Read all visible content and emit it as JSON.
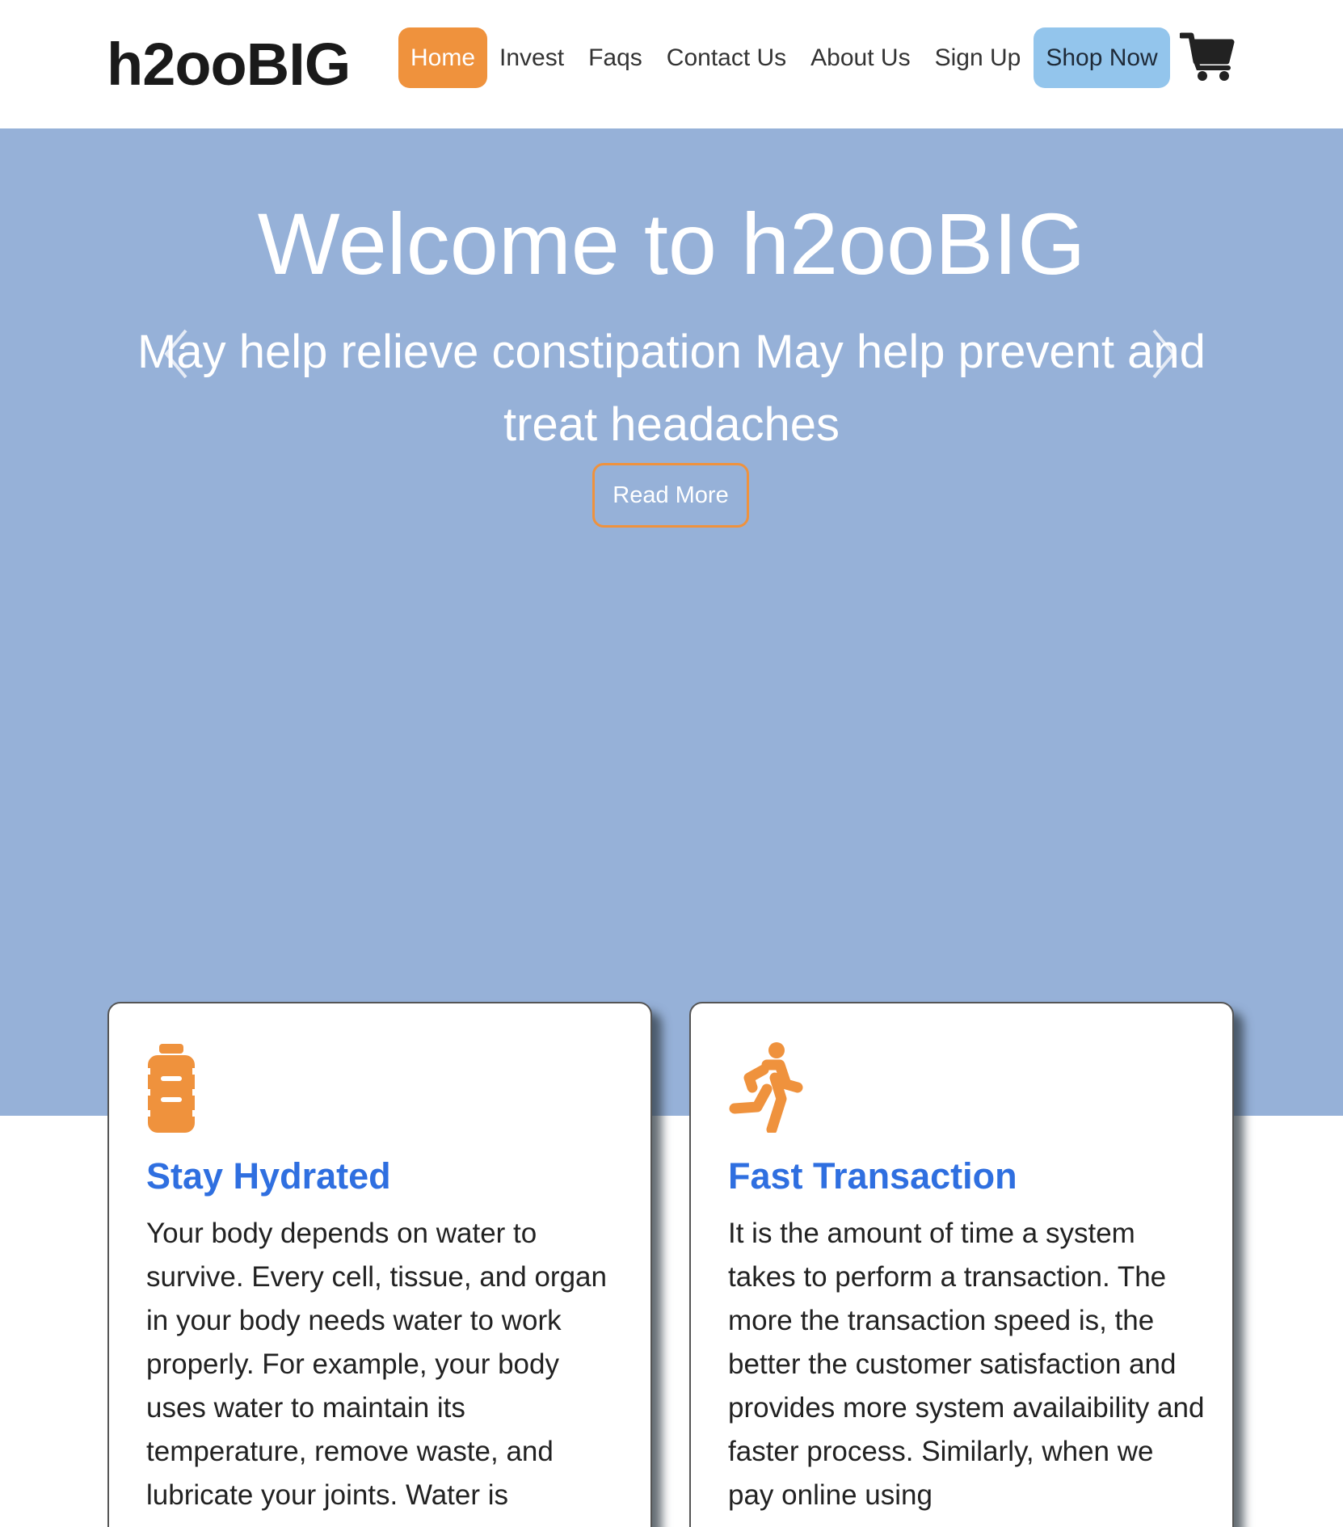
{
  "header": {
    "brand": "h2ooBIG",
    "nav": [
      {
        "label": "Home",
        "active": true
      },
      {
        "label": "Invest"
      },
      {
        "label": "Faqs"
      },
      {
        "label": "Contact Us"
      },
      {
        "label": "About Us"
      },
      {
        "label": "Sign Up"
      }
    ],
    "shop_label": "Shop Now",
    "cart_icon": "shopping-cart-icon"
  },
  "hero": {
    "title": "Welcome to h2ooBIG",
    "subtitle": "May help relieve constipation May help prevent and treat headaches",
    "button_label": "Read More",
    "prev_icon": "chevron-left-icon",
    "next_icon": "chevron-right-icon"
  },
  "cards": [
    {
      "icon": "water-bottle-icon",
      "title": "Stay Hydrated",
      "text": "Your body depends on water to survive. Every cell, tissue, and organ in your body needs water to work properly. For example, your body uses water to maintain its temperature, remove waste, and lubricate your joints. Water is"
    },
    {
      "icon": "running-person-icon",
      "title": "Fast Transaction",
      "text": "It is the amount of time a system takes to perform a transaction. The more the transaction speed is, the better the customer satisfaction and provides more system availaibility and faster process. Similarly, when we pay online using"
    }
  ],
  "colors": {
    "accent": "#ef923d",
    "hero_bg": "#96b1d8",
    "shop_bg": "#93c5ec",
    "card_title": "#2f6fe0"
  }
}
